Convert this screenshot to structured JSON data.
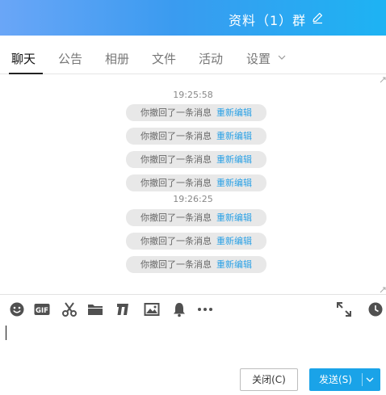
{
  "header": {
    "title": "资料（1）群",
    "edit_icon": "pencil-icon"
  },
  "tabs": [
    {
      "label": "聊天",
      "active": true
    },
    {
      "label": "公告"
    },
    {
      "label": "相册"
    },
    {
      "label": "文件"
    },
    {
      "label": "活动"
    },
    {
      "label": "设置"
    }
  ],
  "chat": {
    "groups": [
      {
        "time": "19:25:58",
        "notices": [
          {
            "text": "你撤回了一条消息",
            "action": "重新编辑"
          },
          {
            "text": "你撤回了一条消息",
            "action": "重新编辑"
          },
          {
            "text": "你撤回了一条消息",
            "action": "重新编辑"
          },
          {
            "text": "你撤回了一条消息",
            "action": "重新编辑"
          }
        ]
      },
      {
        "time": "19:26:25",
        "notices": [
          {
            "text": "你撤回了一条消息",
            "action": "重新编辑"
          },
          {
            "text": "你撤回了一条消息",
            "action": "重新编辑"
          },
          {
            "text": "你撤回了一条消息",
            "action": "重新编辑"
          }
        ]
      }
    ]
  },
  "toolbar": {
    "icons": [
      "emoji-icon",
      "gif-icon",
      "scissors-icon",
      "folder-icon",
      "font-icon",
      "image-icon",
      "bell-icon",
      "more-icon",
      "expand-icon",
      "history-icon"
    ],
    "gif_text": "GIF"
  },
  "buttons": {
    "close_label": "关闭(C)",
    "send_label": "发送(S)"
  },
  "colors": {
    "accent": "#1aa3e8",
    "link": "#2aa1e6",
    "header_start": "#6aa6f7",
    "header_end": "#1db3f3"
  }
}
